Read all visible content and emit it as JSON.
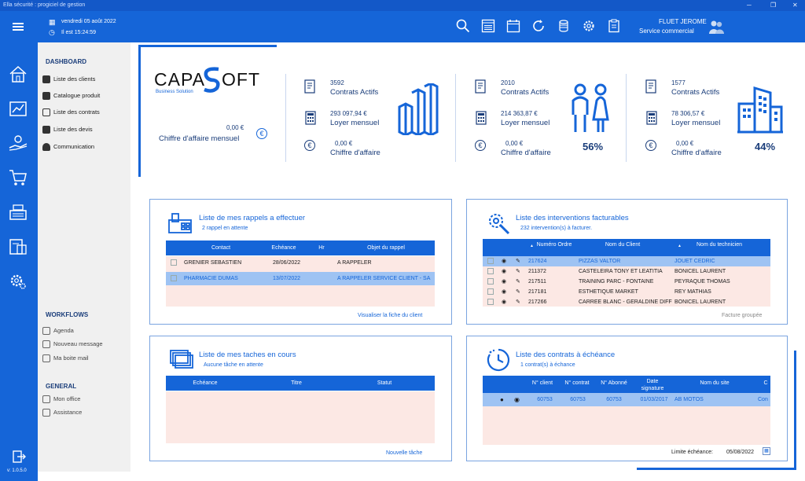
{
  "app": {
    "title": "Ella sécurité : progiciel de gestion",
    "date": "vendredi 05 août 2022",
    "time": "Il est 15:24:59",
    "user": "FLUET JEROME",
    "service": "Service commercial",
    "version": "v: 1.0.5.0"
  },
  "toolbar": {
    "icons": [
      "search-icon",
      "list-icon",
      "calendar-icon",
      "refresh-icon",
      "coins-icon",
      "gear-icon",
      "clipboard-icon"
    ]
  },
  "sidebar": {
    "dashboard_title": "DASHBOARD",
    "dashboard_items": [
      "Liste des clients",
      "Catalogue produit",
      "Liste des contrats",
      "Liste des devis",
      "Communication"
    ],
    "workflows_title": "WORKFLOWS",
    "workflows_items": [
      "Agenda",
      "Nouveau message",
      "Ma boite mail"
    ],
    "general_title": "GENERAL",
    "general_items": [
      "Mon office",
      "Assistance"
    ]
  },
  "brand": {
    "logo_left": "CAPA",
    "logo_right": "OFT",
    "tagline": "Business Solution"
  },
  "kpi": {
    "ca_mensuel_value": "0,00 €",
    "ca_mensuel_label": "Chiffre d'affaire mensuel",
    "groups": [
      {
        "contrats_value": "3592",
        "contrats_label": "Contrats Actifs",
        "loyer_value": "293 097,94 €",
        "loyer_label": "Loyer mensuel",
        "ca_value": "0,00 €",
        "ca_label": "Chiffre d'affaire",
        "percent": ""
      },
      {
        "contrats_value": "2010",
        "contrats_label": "Contrats Actifs",
        "loyer_value": "214 363,87 €",
        "loyer_label": "Loyer mensuel",
        "ca_value": "0,00 €",
        "ca_label": "Chiffre d'affaire",
        "percent": "56%"
      },
      {
        "contrats_value": "1577",
        "contrats_label": "Contrats Actifs",
        "loyer_value": "78 306,57 €",
        "loyer_label": "Loyer mensuel",
        "ca_value": "0,00 €",
        "ca_label": "Chiffre d'affaire",
        "percent": "44%"
      }
    ]
  },
  "rappels": {
    "title": "Liste de mes rappels a effectuer",
    "subtitle": "2 rappel en attente",
    "columns": [
      "Contact",
      "Echéance",
      "Hr",
      "Objet du rappel"
    ],
    "rows": [
      [
        "GRENIER SEBASTIEN",
        "28/06/2022",
        "",
        "A RAPPELER"
      ],
      [
        "PHARMACIE DUMAS",
        "13/07/2022",
        "",
        "A RAPPELER SERVICE CLIENT - SA"
      ]
    ],
    "link": "Visualiser la fiche du client"
  },
  "interventions": {
    "title": "Liste des interventions facturables",
    "subtitle": "232 intervention(s) à facturer.",
    "columns": [
      "Numéro Ordre",
      "Nom du Client",
      "Nom du technicien"
    ],
    "rows": [
      [
        "217624",
        "PIZZAS VALTOR",
        "JOUET CEDRIC"
      ],
      [
        "211372",
        "CASTELEIRA TONY ET LEATITIA",
        "BONICEL LAURENT"
      ],
      [
        "217511",
        "TRAINING PARC - FONTAINE",
        "PEYRAQUE THOMAS"
      ],
      [
        "217181",
        "ESTHETIQUE MARKET",
        "REY MATHIAS"
      ],
      [
        "217266",
        "CARREE BLANC - GERALDINE DIFF",
        "BONICEL LAURENT"
      ]
    ],
    "link": "Facture groupée"
  },
  "taches": {
    "title": "Liste de mes taches en cours",
    "subtitle": "Aucune tâche en attente",
    "columns": [
      "Echéance",
      "Titre",
      "Statut"
    ],
    "link": "Nouvelle tâche"
  },
  "contrats": {
    "title": "Liste des contrats à échéance",
    "subtitle": "1 contrat(s) à échance",
    "columns": [
      "N° client",
      "N° contrat",
      "N° Abonné",
      "Date signature",
      "Nom du site",
      "C"
    ],
    "rows": [
      [
        "60753",
        "60753",
        "60753",
        "01/03/2017",
        "AB MOTOS",
        "Con"
      ]
    ],
    "limit_label": "Limite échéance:",
    "limit_value": "05/08/2022"
  },
  "colors": {
    "primary": "#1565d8",
    "row_bg": "#fce8e4",
    "row_selected": "#9ec3f3"
  }
}
